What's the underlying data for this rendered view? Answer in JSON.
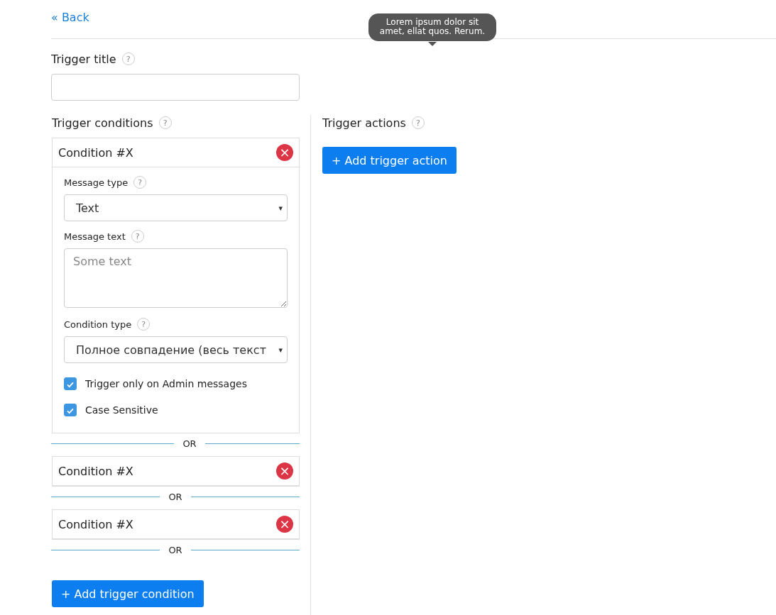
{
  "back_link": "« Back",
  "tooltip": {
    "text": "Lorem ipsum dolor sit amet, ellat quos. Rerum."
  },
  "trigger_title": {
    "label": "Trigger title",
    "help": "?"
  },
  "conditions": {
    "label": "Trigger conditions",
    "help": "?",
    "items": [
      {
        "title": "Condition #X",
        "remove": "×",
        "expanded": true,
        "fields": [
          {
            "kind": "select",
            "label": "Message type",
            "help": "?",
            "value": "Text",
            "caret": "▾"
          },
          {
            "kind": "textarea",
            "label": "Message text",
            "help": "?",
            "placeholder": "Some text"
          },
          {
            "kind": "select",
            "label": "Condition type",
            "help": "?",
            "value": "Полное совпадение (весь текст",
            "caret": "▾"
          },
          {
            "kind": "checkbox",
            "label": "Trigger only on Admin messages",
            "checked": true
          },
          {
            "kind": "checkbox",
            "label": "Case Sensitive",
            "checked": true
          }
        ],
        "separator": "OR"
      },
      {
        "title": "Condition #X",
        "remove": "×",
        "expanded": false,
        "separator": "OR"
      },
      {
        "title": "Condition #X",
        "remove": "×",
        "expanded": false,
        "separator": "OR"
      }
    ],
    "add_button": "+ Add trigger condition"
  },
  "actions": {
    "label": "Trigger actions",
    "help": "?",
    "add_button": "+ Add trigger action"
  }
}
